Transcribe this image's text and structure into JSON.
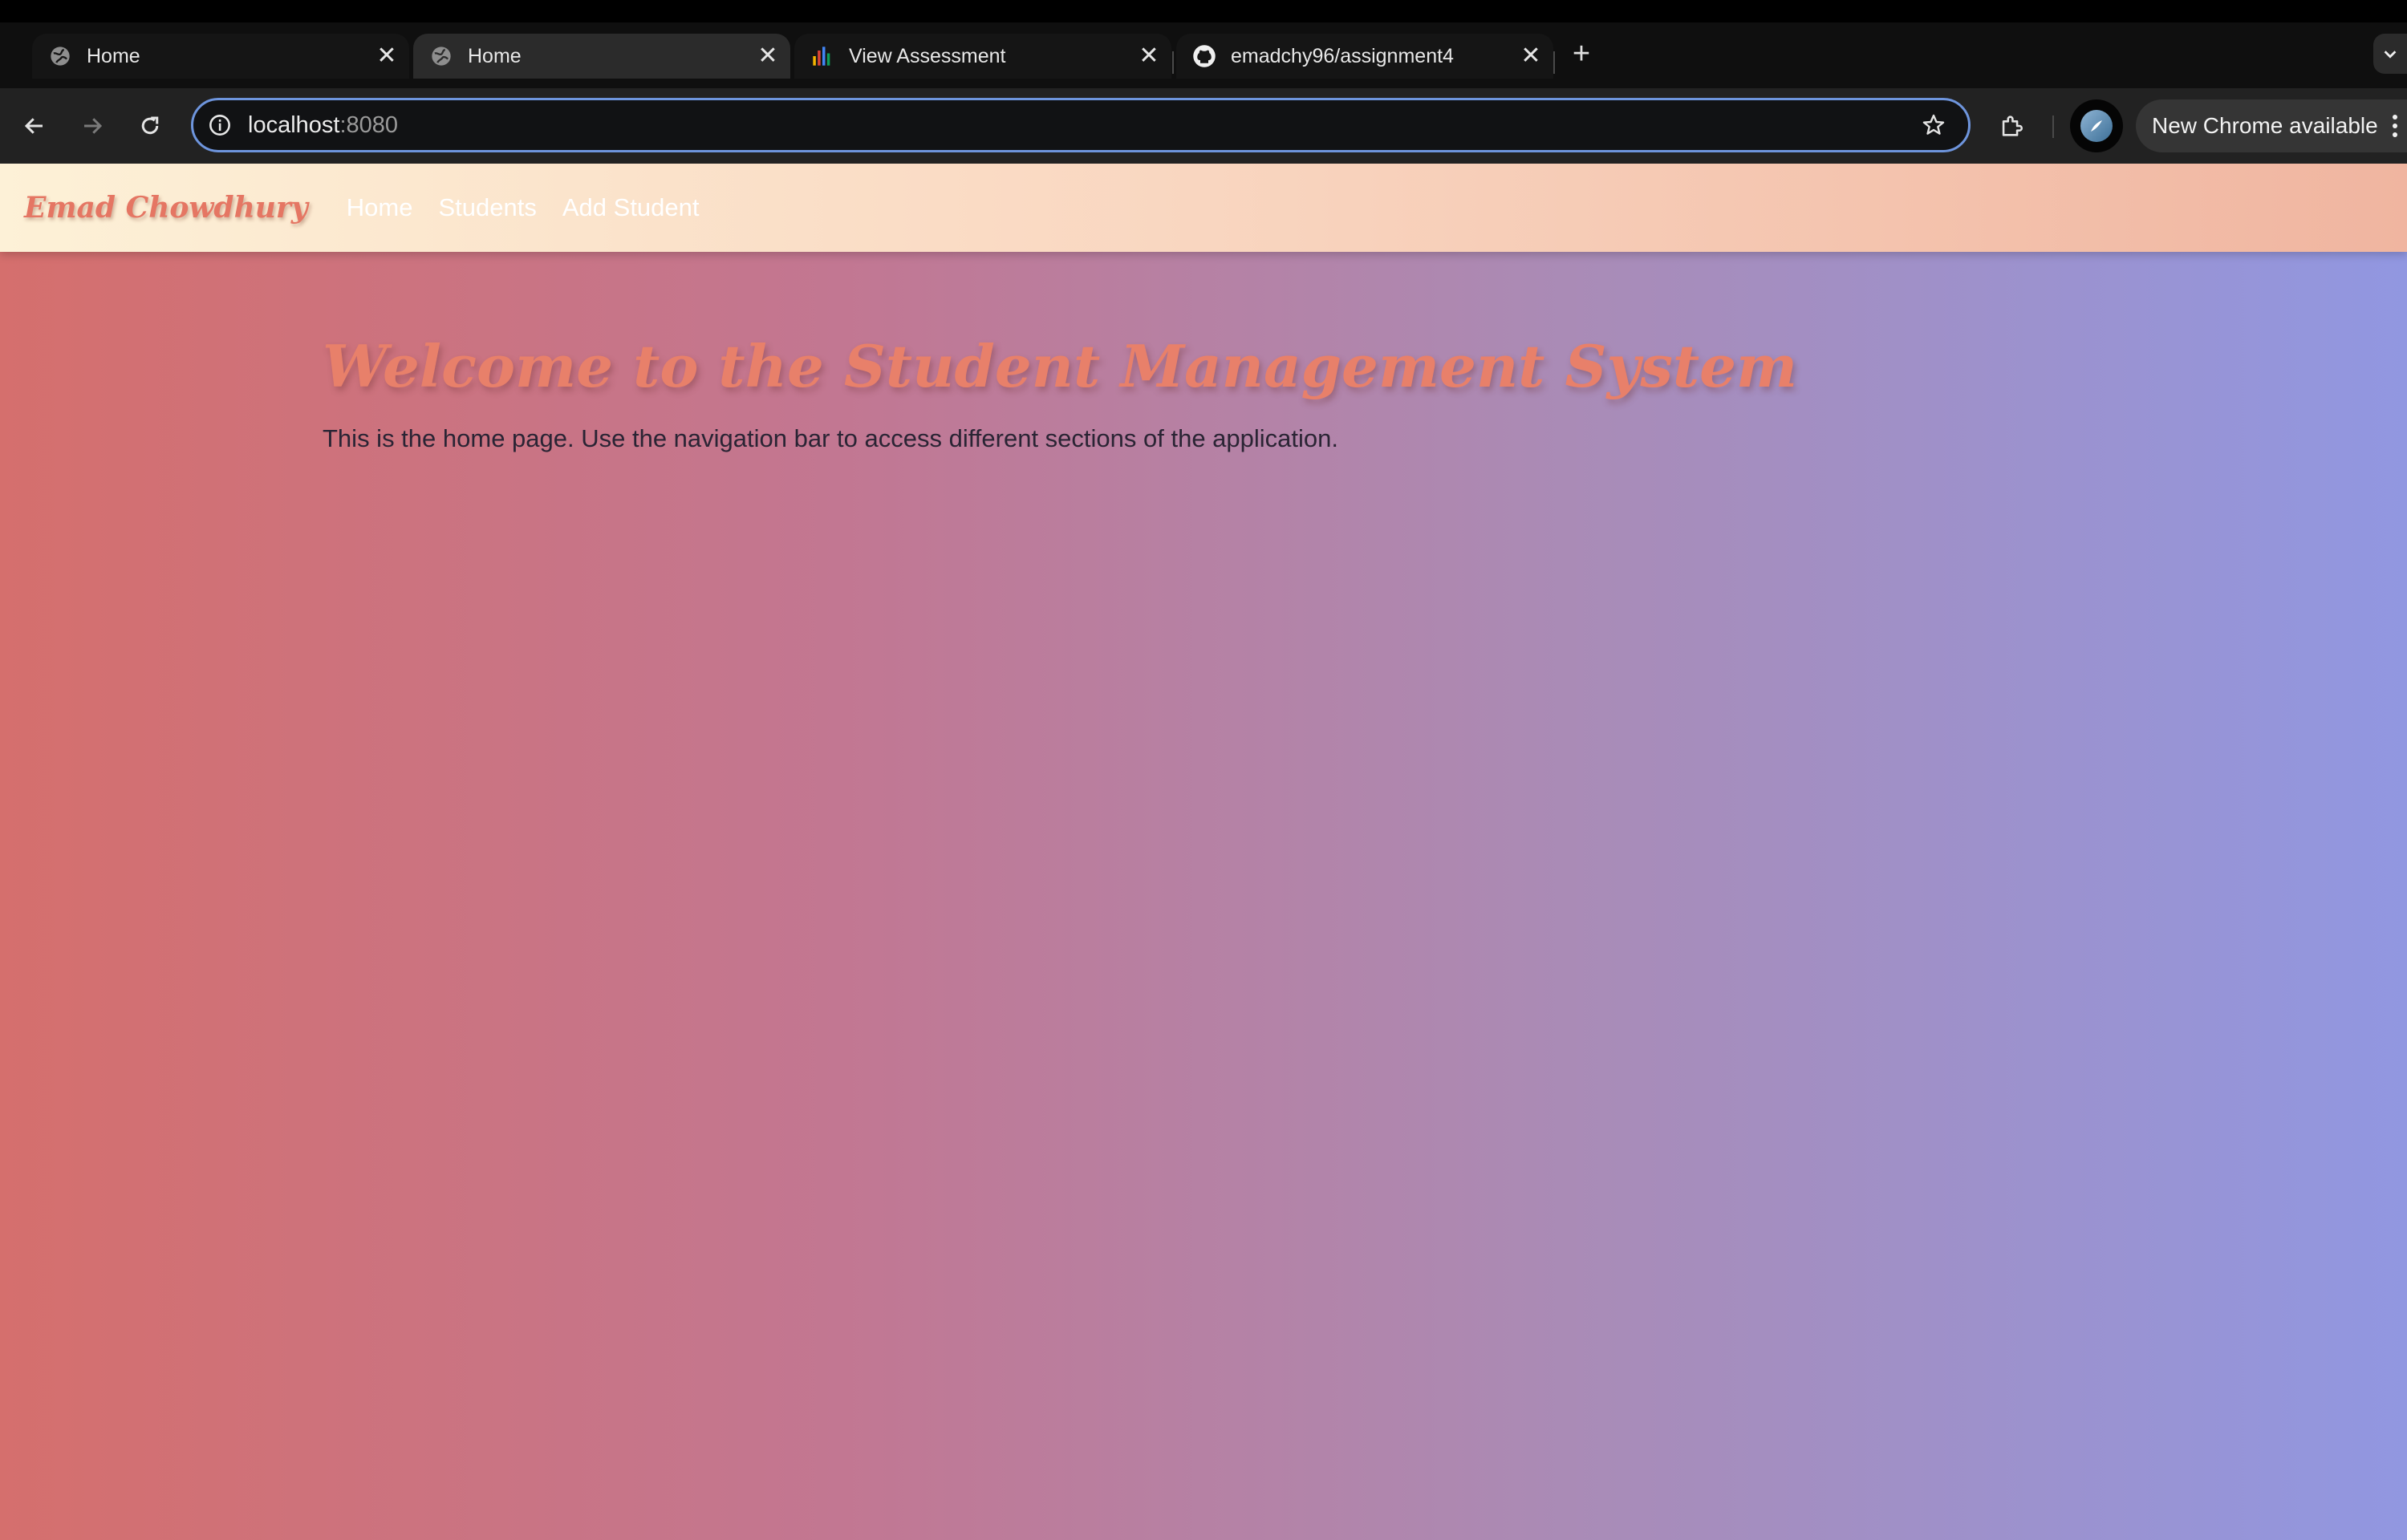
{
  "browser": {
    "tabs": [
      {
        "title": "Home",
        "favicon": "globe-icon",
        "active": false
      },
      {
        "title": "Home",
        "favicon": "globe-icon",
        "active": true
      },
      {
        "title": "View Assessment",
        "favicon": "bar-chart-icon",
        "active": false
      },
      {
        "title": "emadchy96/assignment4",
        "favicon": "github-icon",
        "active": false
      }
    ],
    "url_host": "localhost",
    "url_port": ":8080",
    "update_label": "New Chrome available"
  },
  "site": {
    "brand": "Emad Chowdhury",
    "nav": [
      "Home",
      "Students",
      "Add Student"
    ],
    "heading": "Welcome to the Student Management System",
    "intro": "This is the home page. Use the navigation bar to access different sections of the application."
  },
  "colors": {
    "brand_text": "#e57663",
    "heading_text": "#e8806a",
    "omnibox_focus": "#6e95dd",
    "page_gradient_start": "#d56f6d",
    "page_gradient_end": "#9197e1",
    "navbar_gradient_start": "#fdf1d7",
    "navbar_gradient_end": "#f0b5a0"
  }
}
